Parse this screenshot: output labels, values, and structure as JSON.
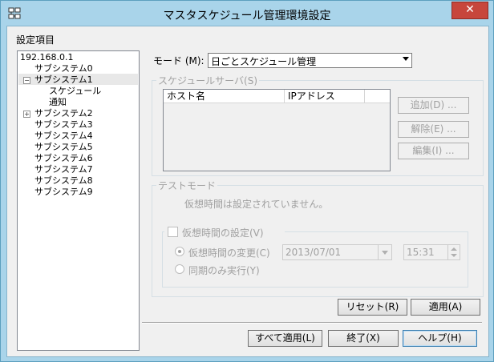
{
  "window": {
    "title": "マスタスケジュール管理環境設定",
    "close_glyph": "✕"
  },
  "settings_label": "設定項目",
  "tree": {
    "root": "192.168.0.1",
    "items": [
      {
        "label": "サブシステム0",
        "expander": ""
      },
      {
        "label": "サブシステム1",
        "expander": "−",
        "selected": true,
        "children": [
          "スケジュール",
          "通知"
        ]
      },
      {
        "label": "サブシステム2",
        "expander": "+"
      },
      {
        "label": "サブシステム3",
        "expander": ""
      },
      {
        "label": "サブシステム4",
        "expander": ""
      },
      {
        "label": "サブシステム5",
        "expander": ""
      },
      {
        "label": "サブシステム6",
        "expander": ""
      },
      {
        "label": "サブシステム7",
        "expander": ""
      },
      {
        "label": "サブシステム8",
        "expander": ""
      },
      {
        "label": "サブシステム9",
        "expander": ""
      }
    ]
  },
  "mode": {
    "label": "モード (M):",
    "value": "日ごとスケジュール管理"
  },
  "schedule_server": {
    "group_title": "スケジュールサーバ(S)",
    "columns": [
      "ホスト名",
      "IPアドレス"
    ],
    "add_button": "追加(D) ...",
    "remove_button": "解除(E) ...",
    "edit_button": "編集(I) ..."
  },
  "test_mode": {
    "group_title": "テストモード",
    "status_text": "仮想時間は設定されていません。",
    "virtual_time_checkbox": "仮想時間の設定(V)",
    "change_radio": "仮想時間の変更(C)",
    "sync_radio": "同期のみ実行(Y)",
    "date_value": "2013/07/01",
    "time_value": "15:31"
  },
  "buttons": {
    "reset": "リセット(R)",
    "apply": "適用(A)",
    "apply_all": "すべて適用(L)",
    "exit": "終了(X)",
    "help": "ヘルプ(H)"
  },
  "colors": {
    "titlebar": "#a9d4ea",
    "close_button": "#c7463c",
    "disabled_text": "#a0a0a0"
  }
}
